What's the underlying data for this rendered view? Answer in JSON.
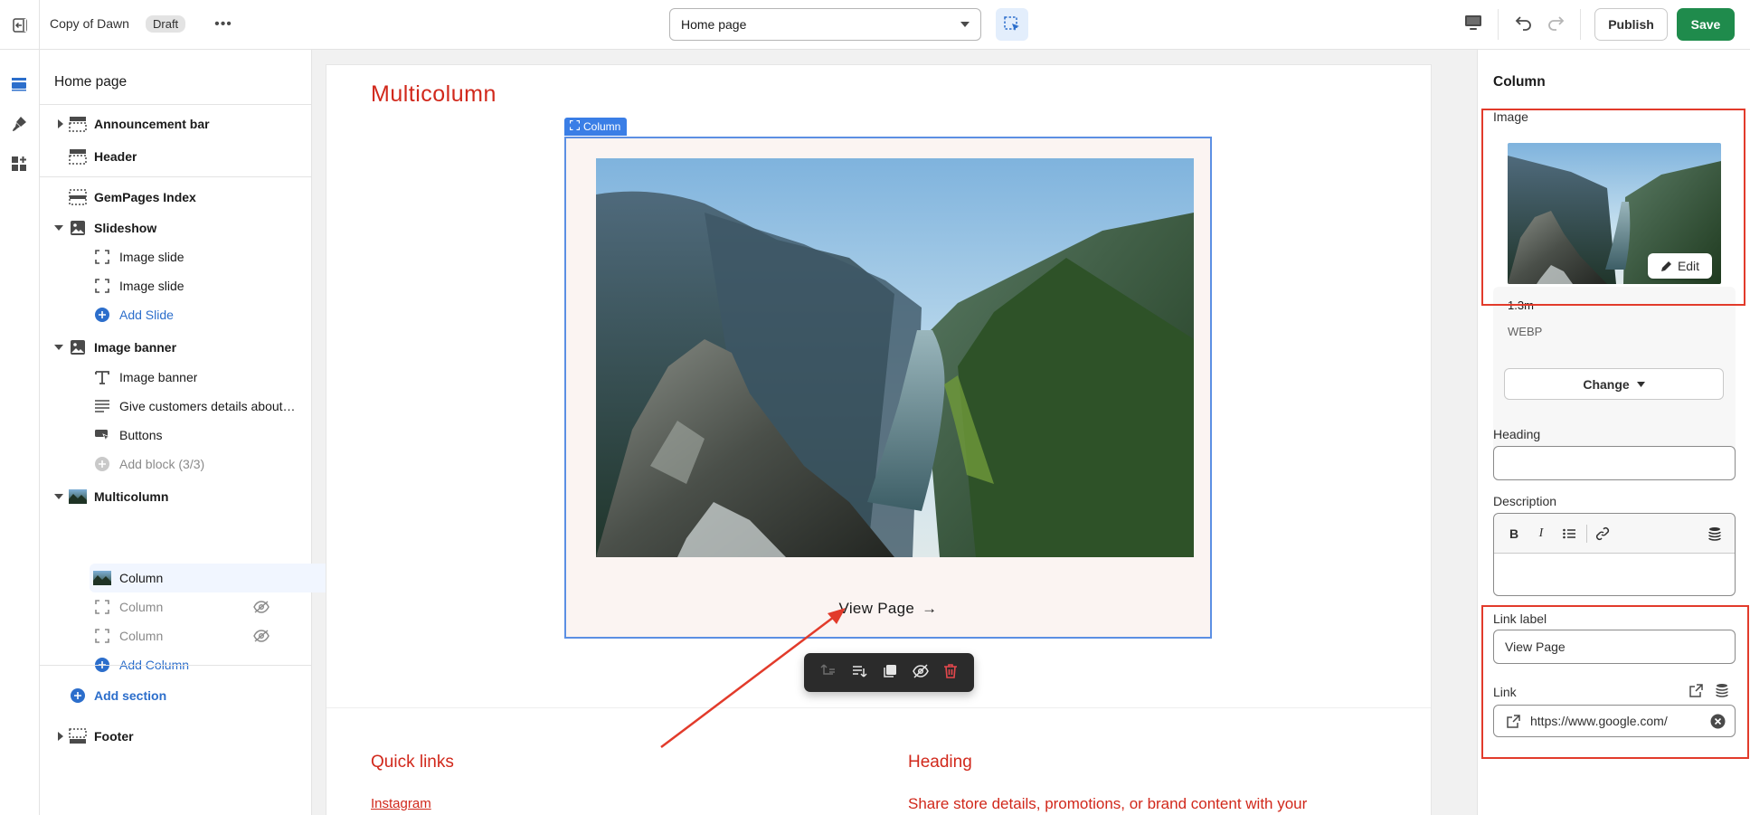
{
  "topbar": {
    "theme_name": "Copy of Dawn",
    "status_badge": "Draft",
    "page_select_value": "Home page",
    "publish_label": "Publish",
    "save_label": "Save"
  },
  "sidebar": {
    "title": "Home page",
    "items": {
      "announcement_bar": "Announcement bar",
      "header": "Header",
      "gempages": "GemPages Index",
      "slideshow": "Slideshow",
      "image_slide_1": "Image slide",
      "image_slide_2": "Image slide",
      "add_slide": "Add Slide",
      "image_banner": "Image banner",
      "image_banner_child": "Image banner",
      "give_customers": "Give customers details about…",
      "buttons": "Buttons",
      "add_block": "Add block (3/3)",
      "multicolumn": "Multicolumn",
      "column_1": "Column",
      "column_2": "Column",
      "column_3": "Column",
      "add_column": "Add Column",
      "add_section": "Add section",
      "footer": "Footer"
    }
  },
  "canvas": {
    "section_title": "Multicolumn",
    "column_tag": "Column",
    "link_text": "View Page",
    "link_arrow": "→",
    "quick_links_title": "Quick links",
    "quick_links_item": "Instagram",
    "heading_title": "Heading",
    "heading_desc": "Share store details, promotions, or brand content with your"
  },
  "panel": {
    "title": "Column",
    "image_label": "Image",
    "edit_label": "Edit",
    "image_size": "1.3m",
    "image_type": "WEBP",
    "change_label": "Change",
    "heading_label": "Heading",
    "heading_value": "",
    "description_label": "Description",
    "link_label_label": "Link label",
    "link_label_value": "View Page",
    "link_label": "Link",
    "link_value": "https://www.google.com/"
  },
  "colors": {
    "accent_red": "#d1281b",
    "selection_blue": "#5c8fe3",
    "save_green": "#1f8b4c",
    "annotation_red": "#e23b2b"
  }
}
